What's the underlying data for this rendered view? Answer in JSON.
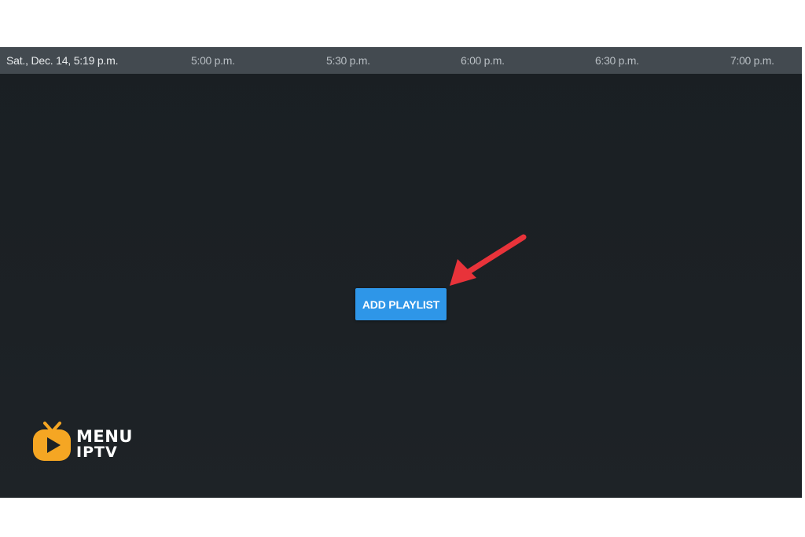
{
  "timebar": {
    "current_datetime": "Sat., Dec. 14, 5:19 p.m.",
    "slots": [
      "5:00 p.m.",
      "5:30 p.m.",
      "6:00 p.m.",
      "6:30 p.m.",
      "7:00 p.m."
    ]
  },
  "main": {
    "add_playlist_label": "ADD PLAYLIST",
    "button_color": "#2e96e8",
    "annotation": "red-arrow-icon"
  },
  "logo": {
    "line1": "MENU",
    "line2": "IPTV",
    "icon": "tv-play-icon",
    "icon_color": "#f5a623"
  }
}
